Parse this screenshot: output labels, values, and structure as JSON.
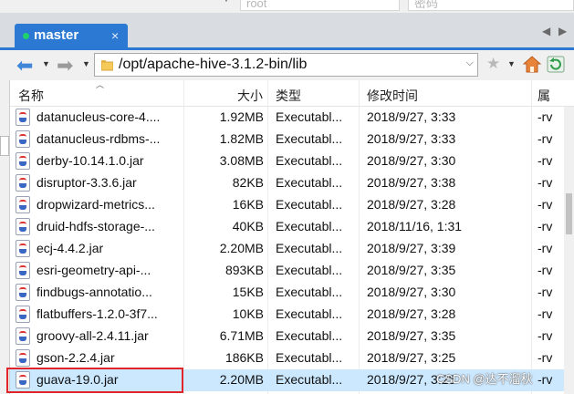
{
  "top_fields": {
    "user_value": "root",
    "password_value": "密码"
  },
  "tab": {
    "label": "master",
    "close": "×"
  },
  "toolbar": {
    "path": "/opt/apache-hive-3.1.2-bin/lib"
  },
  "columns": {
    "name": "名称",
    "size": "大小",
    "type": "类型",
    "modified": "修改时间",
    "attributes": "属"
  },
  "files": [
    {
      "name": "datanucleus-core-4....",
      "size": "1.92MB",
      "type": "Executabl...",
      "modified": "2018/9/27, 3:33",
      "attr": "-rv"
    },
    {
      "name": "datanucleus-rdbms-...",
      "size": "1.82MB",
      "type": "Executabl...",
      "modified": "2018/9/27, 3:33",
      "attr": "-rv"
    },
    {
      "name": "derby-10.14.1.0.jar",
      "size": "3.08MB",
      "type": "Executabl...",
      "modified": "2018/9/27, 3:30",
      "attr": "-rv"
    },
    {
      "name": "disruptor-3.3.6.jar",
      "size": "82KB",
      "type": "Executabl...",
      "modified": "2018/9/27, 3:38",
      "attr": "-rv"
    },
    {
      "name": "dropwizard-metrics...",
      "size": "16KB",
      "type": "Executabl...",
      "modified": "2018/9/27, 3:28",
      "attr": "-rv"
    },
    {
      "name": "druid-hdfs-storage-...",
      "size": "40KB",
      "type": "Executabl...",
      "modified": "2018/11/16, 1:31",
      "attr": "-rv"
    },
    {
      "name": "ecj-4.4.2.jar",
      "size": "2.20MB",
      "type": "Executabl...",
      "modified": "2018/9/27, 3:39",
      "attr": "-rv"
    },
    {
      "name": "esri-geometry-api-...",
      "size": "893KB",
      "type": "Executabl...",
      "modified": "2018/9/27, 3:35",
      "attr": "-rv"
    },
    {
      "name": "findbugs-annotatio...",
      "size": "15KB",
      "type": "Executabl...",
      "modified": "2018/9/27, 3:30",
      "attr": "-rv"
    },
    {
      "name": "flatbuffers-1.2.0-3f7...",
      "size": "10KB",
      "type": "Executabl...",
      "modified": "2018/9/27, 3:28",
      "attr": "-rv"
    },
    {
      "name": "groovy-all-2.4.11.jar",
      "size": "6.71MB",
      "type": "Executabl...",
      "modified": "2018/9/27, 3:35",
      "attr": "-rv"
    },
    {
      "name": "gson-2.2.4.jar",
      "size": "186KB",
      "type": "Executabl...",
      "modified": "2018/9/27, 3:25",
      "attr": "-rv"
    },
    {
      "name": "guava-19.0.jar",
      "size": "2.20MB",
      "type": "Executabl...",
      "modified": "2018/9/27, 3:25",
      "attr": "-rv",
      "selected": true
    }
  ],
  "watermark": "CSDN @达不溜秋",
  "colors": {
    "tab_active": "#2b79d3",
    "selected_row": "#cce8ff",
    "highlight_border": "#e0242a"
  }
}
